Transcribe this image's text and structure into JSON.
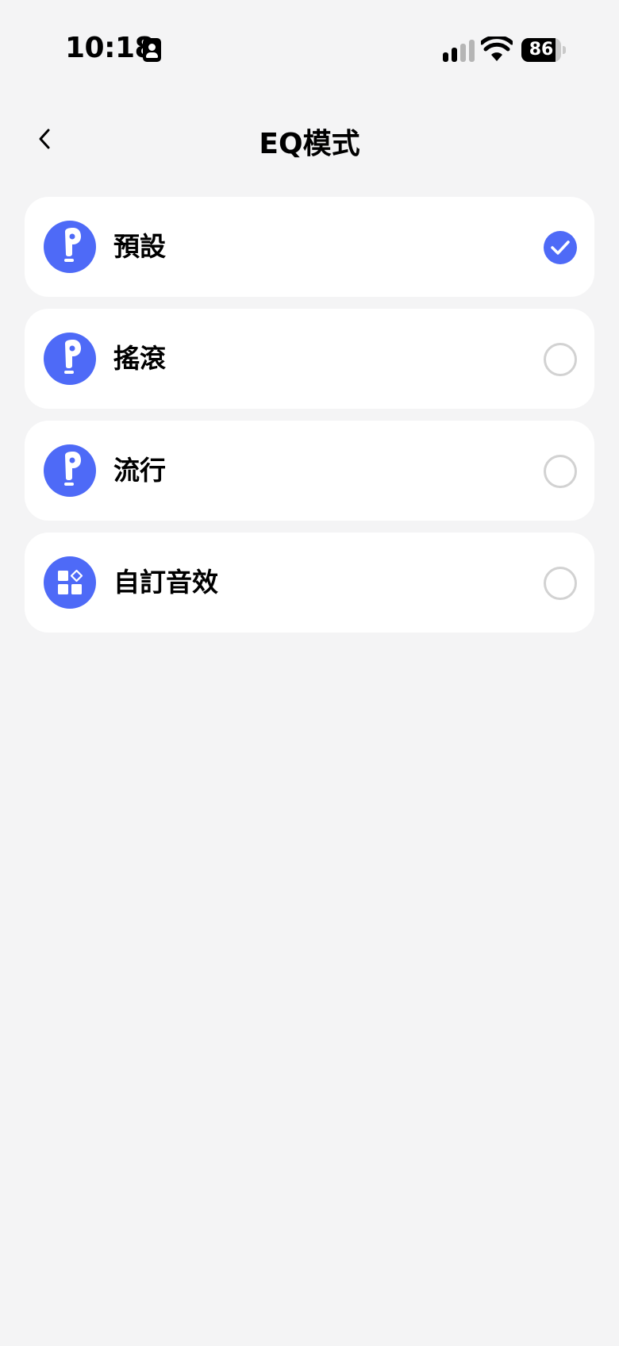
{
  "status_bar": {
    "time": "10:18",
    "battery_level": "86",
    "battery_fraction": 0.86
  },
  "nav": {
    "title": "EQ模式"
  },
  "colors": {
    "accent": "#4e6af7",
    "background": "#f4f4f5",
    "card": "#ffffff",
    "radio_border": "#d2d2d2"
  },
  "options": [
    {
      "label": "預設",
      "icon": "earbud-icon",
      "selected": true
    },
    {
      "label": "搖滾",
      "icon": "earbud-icon",
      "selected": false
    },
    {
      "label": "流行",
      "icon": "earbud-icon",
      "selected": false
    },
    {
      "label": "自訂音效",
      "icon": "widgets-icon",
      "selected": false
    }
  ]
}
